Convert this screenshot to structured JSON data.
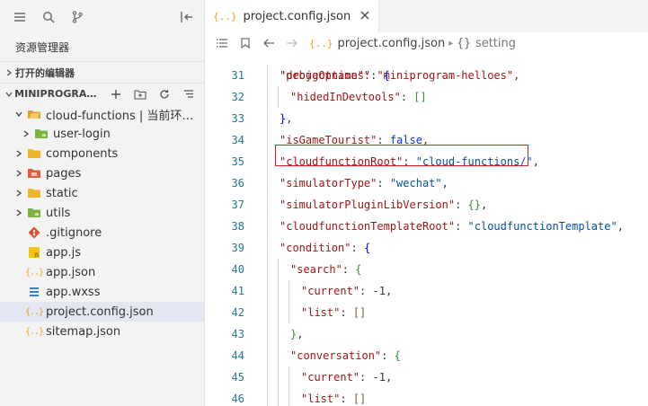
{
  "sidebar": {
    "title": "资源管理器",
    "open_editors": "打开的编辑器",
    "project_section": "MINIPROGRAM-...",
    "tree": [
      {
        "label": "cloud-functions | 当前环境: ...",
        "depth": 0,
        "twist": "down",
        "icon": "cloud-folder-icon",
        "color": "#dca232"
      },
      {
        "label": "user-login",
        "depth": 1,
        "twist": "right",
        "icon": "green-folder-icon",
        "color": "#7cb342"
      },
      {
        "label": "components",
        "depth": 0,
        "twist": "right",
        "icon": "folder-icon",
        "color": "#f0b429"
      },
      {
        "label": "pages",
        "depth": 0,
        "twist": "right",
        "icon": "red-folder-icon",
        "color": "#e35d3b"
      },
      {
        "label": "static",
        "depth": 0,
        "twist": "right",
        "icon": "folder-icon",
        "color": "#f0b429"
      },
      {
        "label": "utils",
        "depth": 0,
        "twist": "right",
        "icon": "green-folder-icon",
        "color": "#7cb342"
      },
      {
        "label": ".gitignore",
        "depth": 0,
        "twist": "none",
        "icon": "git-icon",
        "color": "#e44c30"
      },
      {
        "label": "app.js",
        "depth": 0,
        "twist": "none",
        "icon": "js-file-icon",
        "color": "#f1c40f"
      },
      {
        "label": "app.json",
        "depth": 0,
        "twist": "none",
        "icon": "json-file-icon",
        "color": "#e8a317"
      },
      {
        "label": "app.wxss",
        "depth": 0,
        "twist": "none",
        "icon": "css-file-icon",
        "color": "#3b82c4"
      },
      {
        "label": "project.config.json",
        "depth": 0,
        "twist": "none",
        "icon": "json-file-icon",
        "color": "#e8a317",
        "selected": true
      },
      {
        "label": "sitemap.json",
        "depth": 0,
        "twist": "none",
        "icon": "json-file-icon",
        "color": "#e8a317"
      }
    ]
  },
  "editor": {
    "tab_label": "project.config.json",
    "breadcrumb": {
      "file": "project.config.json",
      "symbol": "setting",
      "symbol_glyph": "{}",
      "json_glyph": "{..}"
    },
    "lines": [
      {
        "n": "31",
        "indent": 1,
        "parts": [
          [
            "k",
            "\"debugOptions\""
          ],
          [
            "p",
            ": "
          ],
          [
            "b",
            "{"
          ]
        ]
      },
      {
        "n": "32",
        "indent": 2,
        "parts": [
          [
            "k",
            "\"hidedInDevtools\""
          ],
          [
            "p",
            ": "
          ],
          [
            "b2",
            "[]"
          ]
        ]
      },
      {
        "n": "33",
        "indent": 1,
        "parts": [
          [
            "b",
            "}"
          ],
          [
            "p",
            ","
          ]
        ]
      },
      {
        "n": "34",
        "indent": 1,
        "parts": [
          [
            "k",
            "\"isGameTourist\""
          ],
          [
            "p",
            ": "
          ],
          [
            "bl",
            "false"
          ],
          [
            "p",
            ","
          ]
        ]
      },
      {
        "n": "35",
        "indent": 1,
        "parts": [
          [
            "k",
            "\"cloudfunctionRoot\""
          ],
          [
            "p",
            ": "
          ],
          [
            "s",
            "\"cloud-functions/\""
          ],
          [
            "p",
            ","
          ]
        ]
      },
      {
        "n": "36",
        "indent": 1,
        "parts": [
          [
            "k",
            "\"simulatorType\""
          ],
          [
            "p",
            ": "
          ],
          [
            "s",
            "\"wechat\""
          ],
          [
            "p",
            ","
          ]
        ]
      },
      {
        "n": "37",
        "indent": 1,
        "parts": [
          [
            "k",
            "\"simulatorPluginLibVersion\""
          ],
          [
            "p",
            ": "
          ],
          [
            "b2",
            "{}"
          ],
          [
            "p",
            ","
          ]
        ]
      },
      {
        "n": "38",
        "indent": 1,
        "parts": [
          [
            "k",
            "\"cloudfunctionTemplateRoot\""
          ],
          [
            "p",
            ": "
          ],
          [
            "s",
            "\"cloudfunctionTemplate\""
          ],
          [
            "p",
            ","
          ]
        ]
      },
      {
        "n": "39",
        "indent": 1,
        "parts": [
          [
            "k",
            "\"condition\""
          ],
          [
            "p",
            ": "
          ],
          [
            "b",
            "{"
          ]
        ]
      },
      {
        "n": "40",
        "indent": 2,
        "parts": [
          [
            "k",
            "\"search\""
          ],
          [
            "p",
            ": "
          ],
          [
            "b2",
            "{"
          ]
        ]
      },
      {
        "n": "41",
        "indent": 3,
        "parts": [
          [
            "k",
            "\"current\""
          ],
          [
            "p",
            ": "
          ],
          [
            "p",
            "-1"
          ],
          [
            "p",
            ","
          ]
        ]
      },
      {
        "n": "42",
        "indent": 3,
        "parts": [
          [
            "k",
            "\"list\""
          ],
          [
            "p",
            ": "
          ],
          [
            "bp",
            "[]"
          ]
        ]
      },
      {
        "n": "43",
        "indent": 2,
        "parts": [
          [
            "b2",
            "}"
          ],
          [
            "p",
            ","
          ]
        ]
      },
      {
        "n": "44",
        "indent": 2,
        "parts": [
          [
            "k",
            "\"conversation\""
          ],
          [
            "p",
            ": "
          ],
          [
            "b2",
            "{"
          ]
        ]
      },
      {
        "n": "45",
        "indent": 3,
        "parts": [
          [
            "k",
            "\"current\""
          ],
          [
            "p",
            ": "
          ],
          [
            "p",
            "-1"
          ],
          [
            "p",
            ","
          ]
        ]
      },
      {
        "n": "46",
        "indent": 3,
        "parts": [
          [
            "k",
            "\"list\""
          ],
          [
            "p",
            ": "
          ],
          [
            "bp",
            "[]"
          ]
        ]
      }
    ],
    "highlighted_line": "35",
    "partial_top_line": "\"projectname\": \"miniprogram-helloes\","
  }
}
